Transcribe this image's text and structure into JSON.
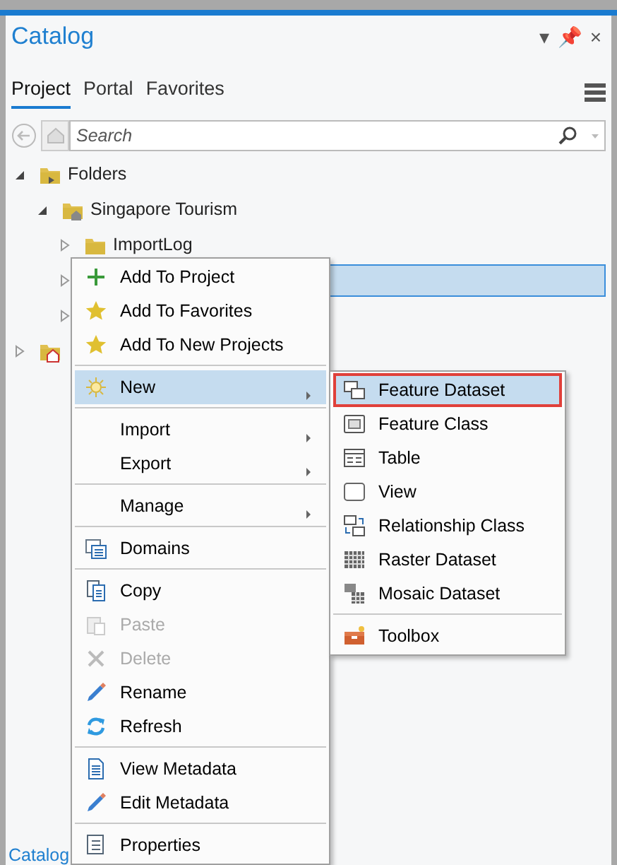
{
  "panel": {
    "title": "Catalog",
    "controls": [
      "▾",
      "📌",
      "×"
    ]
  },
  "tabs": [
    {
      "label": "Project",
      "selected": true
    },
    {
      "label": "Portal",
      "selected": false
    },
    {
      "label": "Favorites",
      "selected": false
    }
  ],
  "search": {
    "placeholder": "Search"
  },
  "tree": [
    {
      "label": "Folders",
      "expanded": true,
      "selected": false,
      "children": [
        {
          "label": "Singapore Tourism",
          "expanded": true,
          "selected": false,
          "children": [
            {
              "label": "ImportLog",
              "expanded": false,
              "selected": false
            },
            {
              "expanded": false,
              "selected": true
            },
            {
              "expanded": false,
              "selected": false
            }
          ]
        }
      ]
    },
    {
      "expanded": false,
      "selected": false
    }
  ],
  "context_menu": [
    {
      "kind": "item",
      "label": "Add To Project",
      "disabled": false,
      "selected": false,
      "submenu": false
    },
    {
      "kind": "item",
      "label": "Add To Favorites",
      "disabled": false,
      "selected": false,
      "submenu": false
    },
    {
      "kind": "item",
      "label": "Add To New Projects",
      "disabled": false,
      "selected": false,
      "submenu": false
    },
    {
      "kind": "separator"
    },
    {
      "kind": "item",
      "label": "New",
      "disabled": false,
      "selected": true,
      "submenu": true
    },
    {
      "kind": "separator"
    },
    {
      "kind": "item",
      "label": "Import",
      "disabled": false,
      "selected": false,
      "submenu": true
    },
    {
      "kind": "item",
      "label": "Export",
      "disabled": false,
      "selected": false,
      "submenu": true
    },
    {
      "kind": "separator"
    },
    {
      "kind": "item",
      "label": "Manage",
      "disabled": false,
      "selected": false,
      "submenu": true
    },
    {
      "kind": "separator"
    },
    {
      "kind": "item",
      "label": "Domains",
      "disabled": false,
      "selected": false,
      "submenu": false
    },
    {
      "kind": "separator"
    },
    {
      "kind": "item",
      "label": "Copy",
      "disabled": false,
      "selected": false,
      "submenu": false
    },
    {
      "kind": "item",
      "label": "Paste",
      "disabled": true,
      "selected": false,
      "submenu": false
    },
    {
      "kind": "item",
      "label": "Delete",
      "disabled": true,
      "selected": false,
      "submenu": false
    },
    {
      "kind": "item",
      "label": "Rename",
      "disabled": false,
      "selected": false,
      "submenu": false
    },
    {
      "kind": "item",
      "label": "Refresh",
      "disabled": false,
      "selected": false,
      "submenu": false
    },
    {
      "kind": "separator"
    },
    {
      "kind": "item",
      "label": "View Metadata",
      "disabled": false,
      "selected": false,
      "submenu": false
    },
    {
      "kind": "item",
      "label": "Edit Metadata",
      "disabled": false,
      "selected": false,
      "submenu": false
    },
    {
      "kind": "separator"
    },
    {
      "kind": "item",
      "label": "Properties",
      "disabled": false,
      "selected": false,
      "submenu": false
    }
  ],
  "submenu": [
    {
      "kind": "item",
      "label": "Feature Dataset",
      "selected": true,
      "highlighted_box": true
    },
    {
      "kind": "item",
      "label": "Feature Class",
      "selected": false,
      "highlighted_box": false
    },
    {
      "kind": "item",
      "label": "Table",
      "selected": false,
      "highlighted_box": false
    },
    {
      "kind": "item",
      "label": "View",
      "selected": false,
      "highlighted_box": false
    },
    {
      "kind": "item",
      "label": "Relationship Class",
      "selected": false,
      "highlighted_box": false
    },
    {
      "kind": "item",
      "label": "Raster Dataset",
      "selected": false,
      "highlighted_box": false
    },
    {
      "kind": "item",
      "label": "Mosaic Dataset",
      "selected": false,
      "highlighted_box": false
    },
    {
      "kind": "separator"
    },
    {
      "kind": "item",
      "label": "Toolbox",
      "selected": false,
      "highlighted_box": false
    }
  ],
  "bottom_tabs": [
    {
      "label": "Catalog",
      "selected": true
    }
  ]
}
